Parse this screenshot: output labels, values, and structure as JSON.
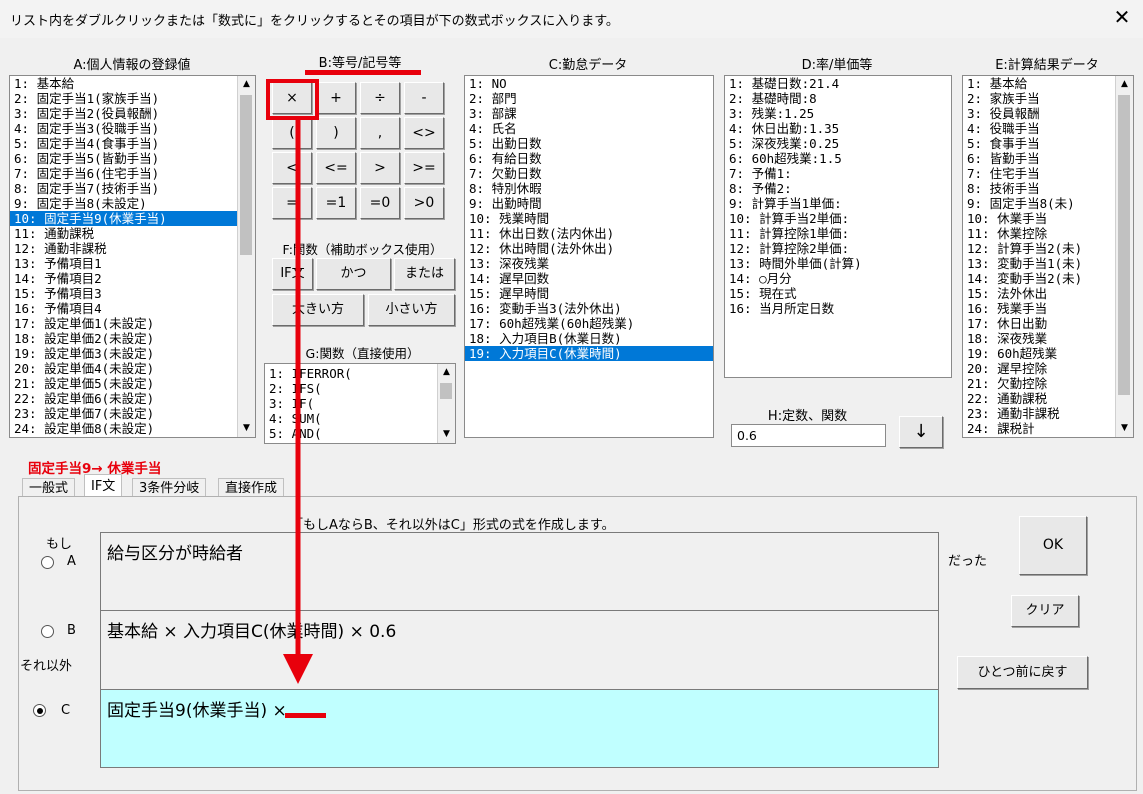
{
  "window": {
    "title": "リスト内をダブルクリックまたは「数式に」をクリックするとその項目が下の数式ボックスに入ります。",
    "close_glyph": "✕"
  },
  "headers": {
    "a": "A:個人情報の登録値",
    "b": "B:等号/記号等",
    "c": "C:勤怠データ",
    "d": "D:率/単価等",
    "e": "E:計算結果データ",
    "f": "F:関数（補助ボックス使用）",
    "g": "G:関数（直接使用）",
    "h": "H:定数、関数"
  },
  "list_a": [
    " 1: 基本給",
    " 2: 固定手当1(家族手当)",
    " 3: 固定手当2(役員報酬)",
    " 4: 固定手当3(役職手当)",
    " 5: 固定手当4(食事手当)",
    " 6: 固定手当5(皆勤手当)",
    " 7: 固定手当6(住宅手当)",
    " 8: 固定手当7(技術手当)",
    " 9: 固定手当8(未設定)",
    "10: 固定手当9(休業手当)",
    "11: 通勤課税",
    "12: 通勤非課税",
    "13: 予備項目1",
    "14: 予備項目2",
    "15: 予備項目3",
    "16: 予備項目4",
    "17: 設定単価1(未設定)",
    "18: 設定単価2(未設定)",
    "19: 設定単価3(未設定)",
    "20: 設定単価4(未設定)",
    "21: 設定単価5(未設定)",
    "22: 設定単価6(未設定)",
    "23: 設定単価7(未設定)",
    "24: 設定単価8(未設定)"
  ],
  "list_c": [
    " 1: NO",
    " 2: 部門",
    " 3: 部課",
    " 4: 氏名",
    " 5: 出勤日数",
    " 6: 有給日数",
    " 7: 欠勤日数",
    " 8: 特別休暇",
    " 9: 出勤時間",
    "10: 残業時間",
    "11: 休出日数(法内休出)",
    "12: 休出時間(法外休出)",
    "13: 深夜残業",
    "14: 遅早回数",
    "15: 遅早時間",
    "16: 変動手当3(法外休出)",
    "17: 60h超残業(60h超残業)",
    "18: 入力項目B(休業日数)",
    "19: 入力項目C(休業時間)"
  ],
  "list_d": [
    " 1: 基礎日数:21.4",
    " 2: 基礎時間:8",
    " 3: 残業:1.25",
    " 4: 休日出勤:1.35",
    " 5: 深夜残業:0.25",
    " 6: 60h超残業:1.5",
    " 7: 予備1:",
    " 8: 予備2:",
    " 9: 計算手当1単価:",
    "10: 計算手当2単価:",
    "11: 計算控除1単価:",
    "12: 計算控除2単価:",
    "13: 時間外単価(計算)",
    "14: ○月分",
    "15: 現在式",
    "16: 当月所定日数"
  ],
  "list_e": [
    " 1: 基本給",
    " 2: 家族手当",
    " 3: 役員報酬",
    " 4: 役職手当",
    " 5: 食事手当",
    " 6: 皆勤手当",
    " 7: 住宅手当",
    " 8: 技術手当",
    " 9: 固定手当8(未)",
    "10: 休業手当",
    "11: 休業控除",
    "12: 計算手当2(未)",
    "13: 変動手当1(未)",
    "14: 変動手当2(未)",
    "15: 法外休出",
    "16: 残業手当",
    "17: 休日出勤",
    "18: 深夜残業",
    "19: 60h超残業",
    "20: 遅早控除",
    "21: 欠勤控除",
    "22: 通勤課税",
    "23: 通勤非課税",
    "24: 課税計"
  ],
  "list_g": [
    " 1: IFERROR(",
    " 2: IFS(",
    " 3: IF(",
    " 4: SUM(",
    " 5: AND("
  ],
  "symbols": [
    "×",
    "+",
    "÷",
    "-",
    "(",
    ")",
    ",",
    "<>",
    "<",
    "<=",
    ">",
    ">=",
    "=",
    "=1",
    "=0",
    ">0"
  ],
  "func_buttons": [
    "IF文",
    "かつ",
    "または",
    "大きい方",
    "小さい方"
  ],
  "constant_value": "0.6",
  "down_arrow": "↓",
  "status": "固定手当9→ 休業手当",
  "tabs": [
    "一般式",
    "IF文",
    "3条件分岐",
    "直接作成"
  ],
  "if_panel": {
    "description": "「もしAならB、それ以外はC」形式の式を作成します。",
    "label_moshi": "もし",
    "label_a": "A",
    "label_b": "B",
    "label_else": "それ以外",
    "label_c": "C",
    "label_datta": "だった",
    "field_a": "給与区分が時給者",
    "field_b": "基本給 × 入力項目C(休業時間) × 0.6",
    "field_c": "固定手当9(休業手当) ×"
  },
  "buttons": {
    "ok": "OK",
    "clear": "クリア",
    "undo": "ひとつ前に戻す"
  },
  "colors": {
    "selection": "#0078d7",
    "highlight_red": "#e8000c",
    "active_field": "#c0ffff",
    "status_red": "#e8000c"
  }
}
